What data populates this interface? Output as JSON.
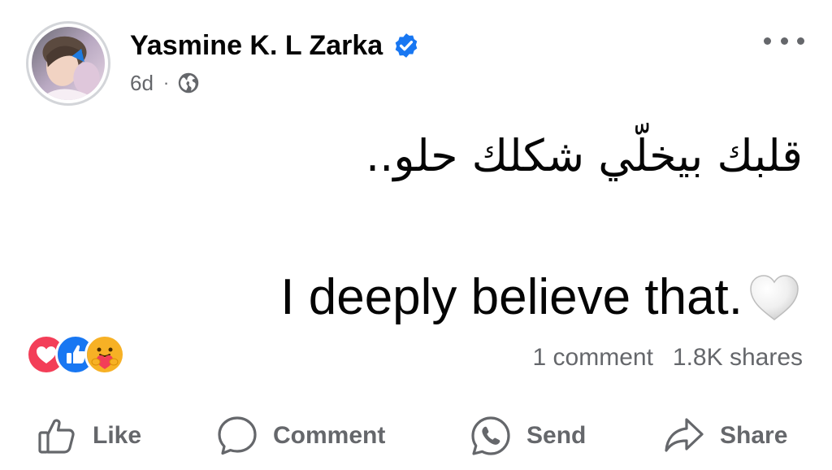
{
  "post": {
    "author": "Yasmine K. L Zarka",
    "time": "6d",
    "separator": "·",
    "privacy_icon": "globe-icon",
    "verified_icon": "verified-badge-icon",
    "text_arabic": "قلبك بيخلّي شكلك حلو..",
    "text_english": "I deeply believe that.",
    "text_emoji": "white-heart-icon"
  },
  "reactions": {
    "icons": [
      "love-reaction-icon",
      "like-reaction-icon",
      "care-reaction-icon"
    ],
    "comments": "1 comment",
    "shares": "1.8K shares"
  },
  "actions": {
    "like": "Like",
    "comment": "Comment",
    "send": "Send",
    "share": "Share"
  },
  "colors": {
    "verified": "#1877f2",
    "like_blue": "#1877f2",
    "love_red": "#f33e58",
    "care_yellow": "#f7b125",
    "secondary_text": "#65676b",
    "primary_text": "#050505"
  }
}
